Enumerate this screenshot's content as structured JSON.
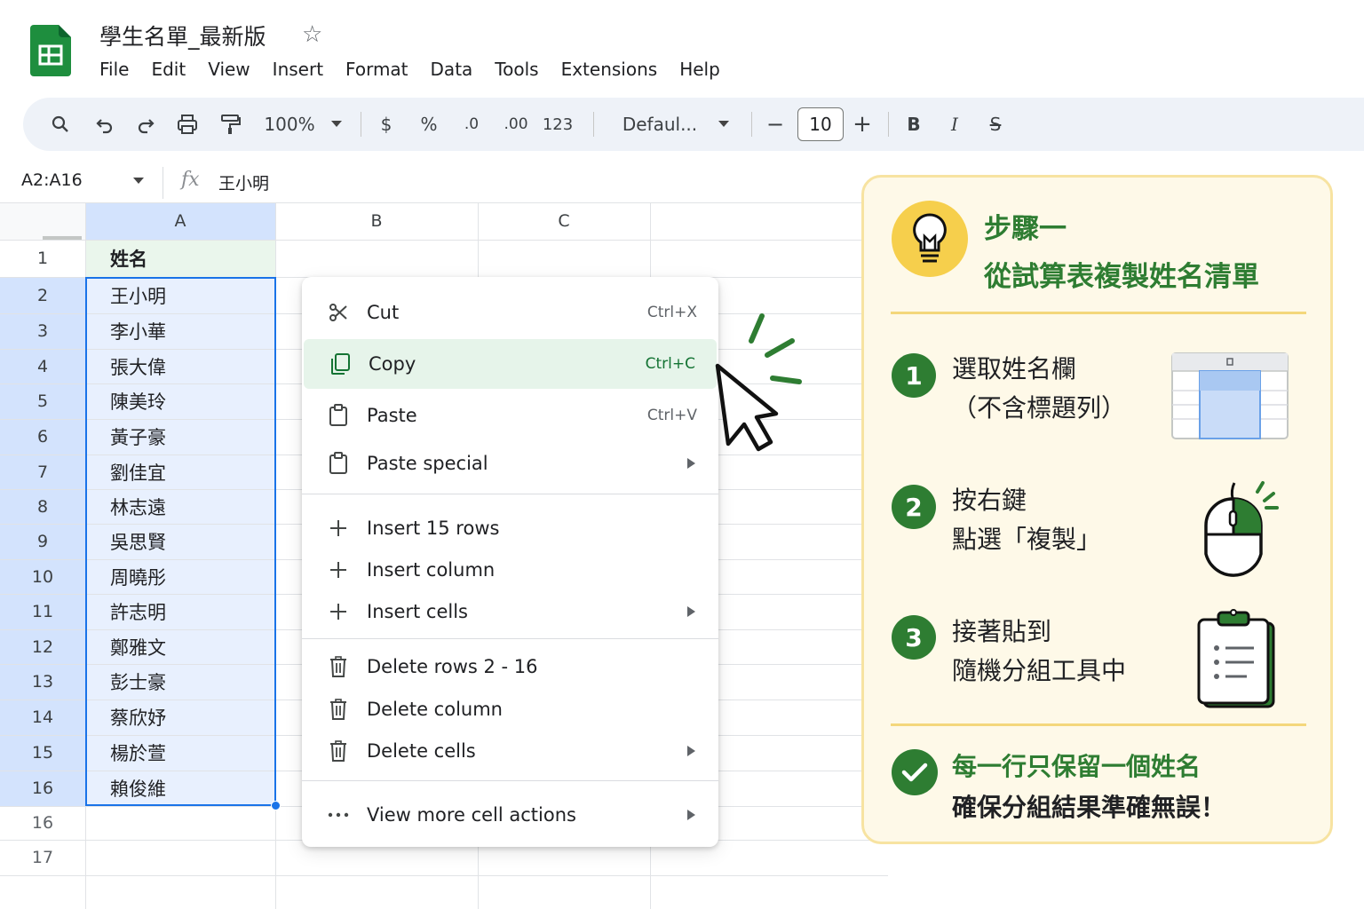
{
  "header": {
    "doc_title": "學生名單_最新版",
    "menu": [
      "File",
      "Edit",
      "View",
      "Insert",
      "Format",
      "Data",
      "Tools",
      "Extensions",
      "Help"
    ]
  },
  "toolbar": {
    "zoom": "100%",
    "currency": "$",
    "percent": "%",
    "dec_decrease": ".0",
    "dec_increase": ".00",
    "number_format": "123",
    "font": "Defaul...",
    "font_size": "10",
    "minus": "−",
    "plus": "+",
    "bold": "B",
    "italic": "I",
    "strike": "S"
  },
  "formula_bar": {
    "range": "A2:A16",
    "fx": "fx",
    "value": "王小明"
  },
  "grid": {
    "columns": [
      "A",
      "B",
      "C"
    ],
    "row_numbers": [
      "1",
      "2",
      "3",
      "4",
      "5",
      "6",
      "7",
      "8",
      "9",
      "10",
      "11",
      "12",
      "13",
      "14",
      "15",
      "16",
      "16",
      "17"
    ],
    "cells": [
      "姓名",
      "王小明",
      "李小華",
      "張大偉",
      "陳美玲",
      "黃子豪",
      "劉佳宜",
      "林志遠",
      "吳思賢",
      "周曉彤",
      "許志明",
      "鄭雅文",
      "彭士豪",
      "蔡欣妤",
      "楊於萱",
      "賴俊維",
      "",
      ""
    ]
  },
  "context_menu": {
    "items": [
      {
        "label": "Cut",
        "shortcut": "Ctrl+X",
        "icon": "scissors-icon"
      },
      {
        "label": "Copy",
        "shortcut": "Ctrl+C",
        "icon": "copy-icon",
        "highlighted": true
      },
      {
        "label": "Paste",
        "shortcut": "Ctrl+V",
        "icon": "clipboard-icon"
      },
      {
        "label": "Paste special",
        "shortcut": "",
        "icon": "clipboard-icon",
        "submenu": true
      },
      {
        "label": "Insert 15 rows",
        "icon": "plus-icon"
      },
      {
        "label": "Insert column",
        "icon": "plus-icon"
      },
      {
        "label": "Insert cells",
        "icon": "plus-icon",
        "submenu": true
      },
      {
        "label": "Delete rows 2 - 16",
        "icon": "trash-icon"
      },
      {
        "label": "Delete column",
        "icon": "trash-icon"
      },
      {
        "label": "Delete cells",
        "icon": "trash-icon",
        "submenu": true
      },
      {
        "label": "View more cell actions",
        "icon": "more-dots-icon",
        "submenu": true
      }
    ]
  },
  "panel": {
    "step": "步驟一",
    "title": "從試算表複製姓名清單",
    "steps": [
      {
        "num": "1",
        "line1": "選取姓名欄",
        "line2": "（不含標題列）"
      },
      {
        "num": "2",
        "line1": "按右鍵",
        "line2": "點選「複製」"
      },
      {
        "num": "3",
        "line1": "接著貼到",
        "line2": "隨機分組工具中"
      }
    ],
    "note_line1": "每一行只保留一個姓名",
    "note_line2": "確保分組結果準確無誤！"
  },
  "colors": {
    "accent_green": "#2e7d32",
    "selection_blue": "#1a73e8",
    "selection_fill": "#e8f0fe",
    "panel_bg": "#fef9e8",
    "bulb_yellow": "#f6cf4c"
  }
}
